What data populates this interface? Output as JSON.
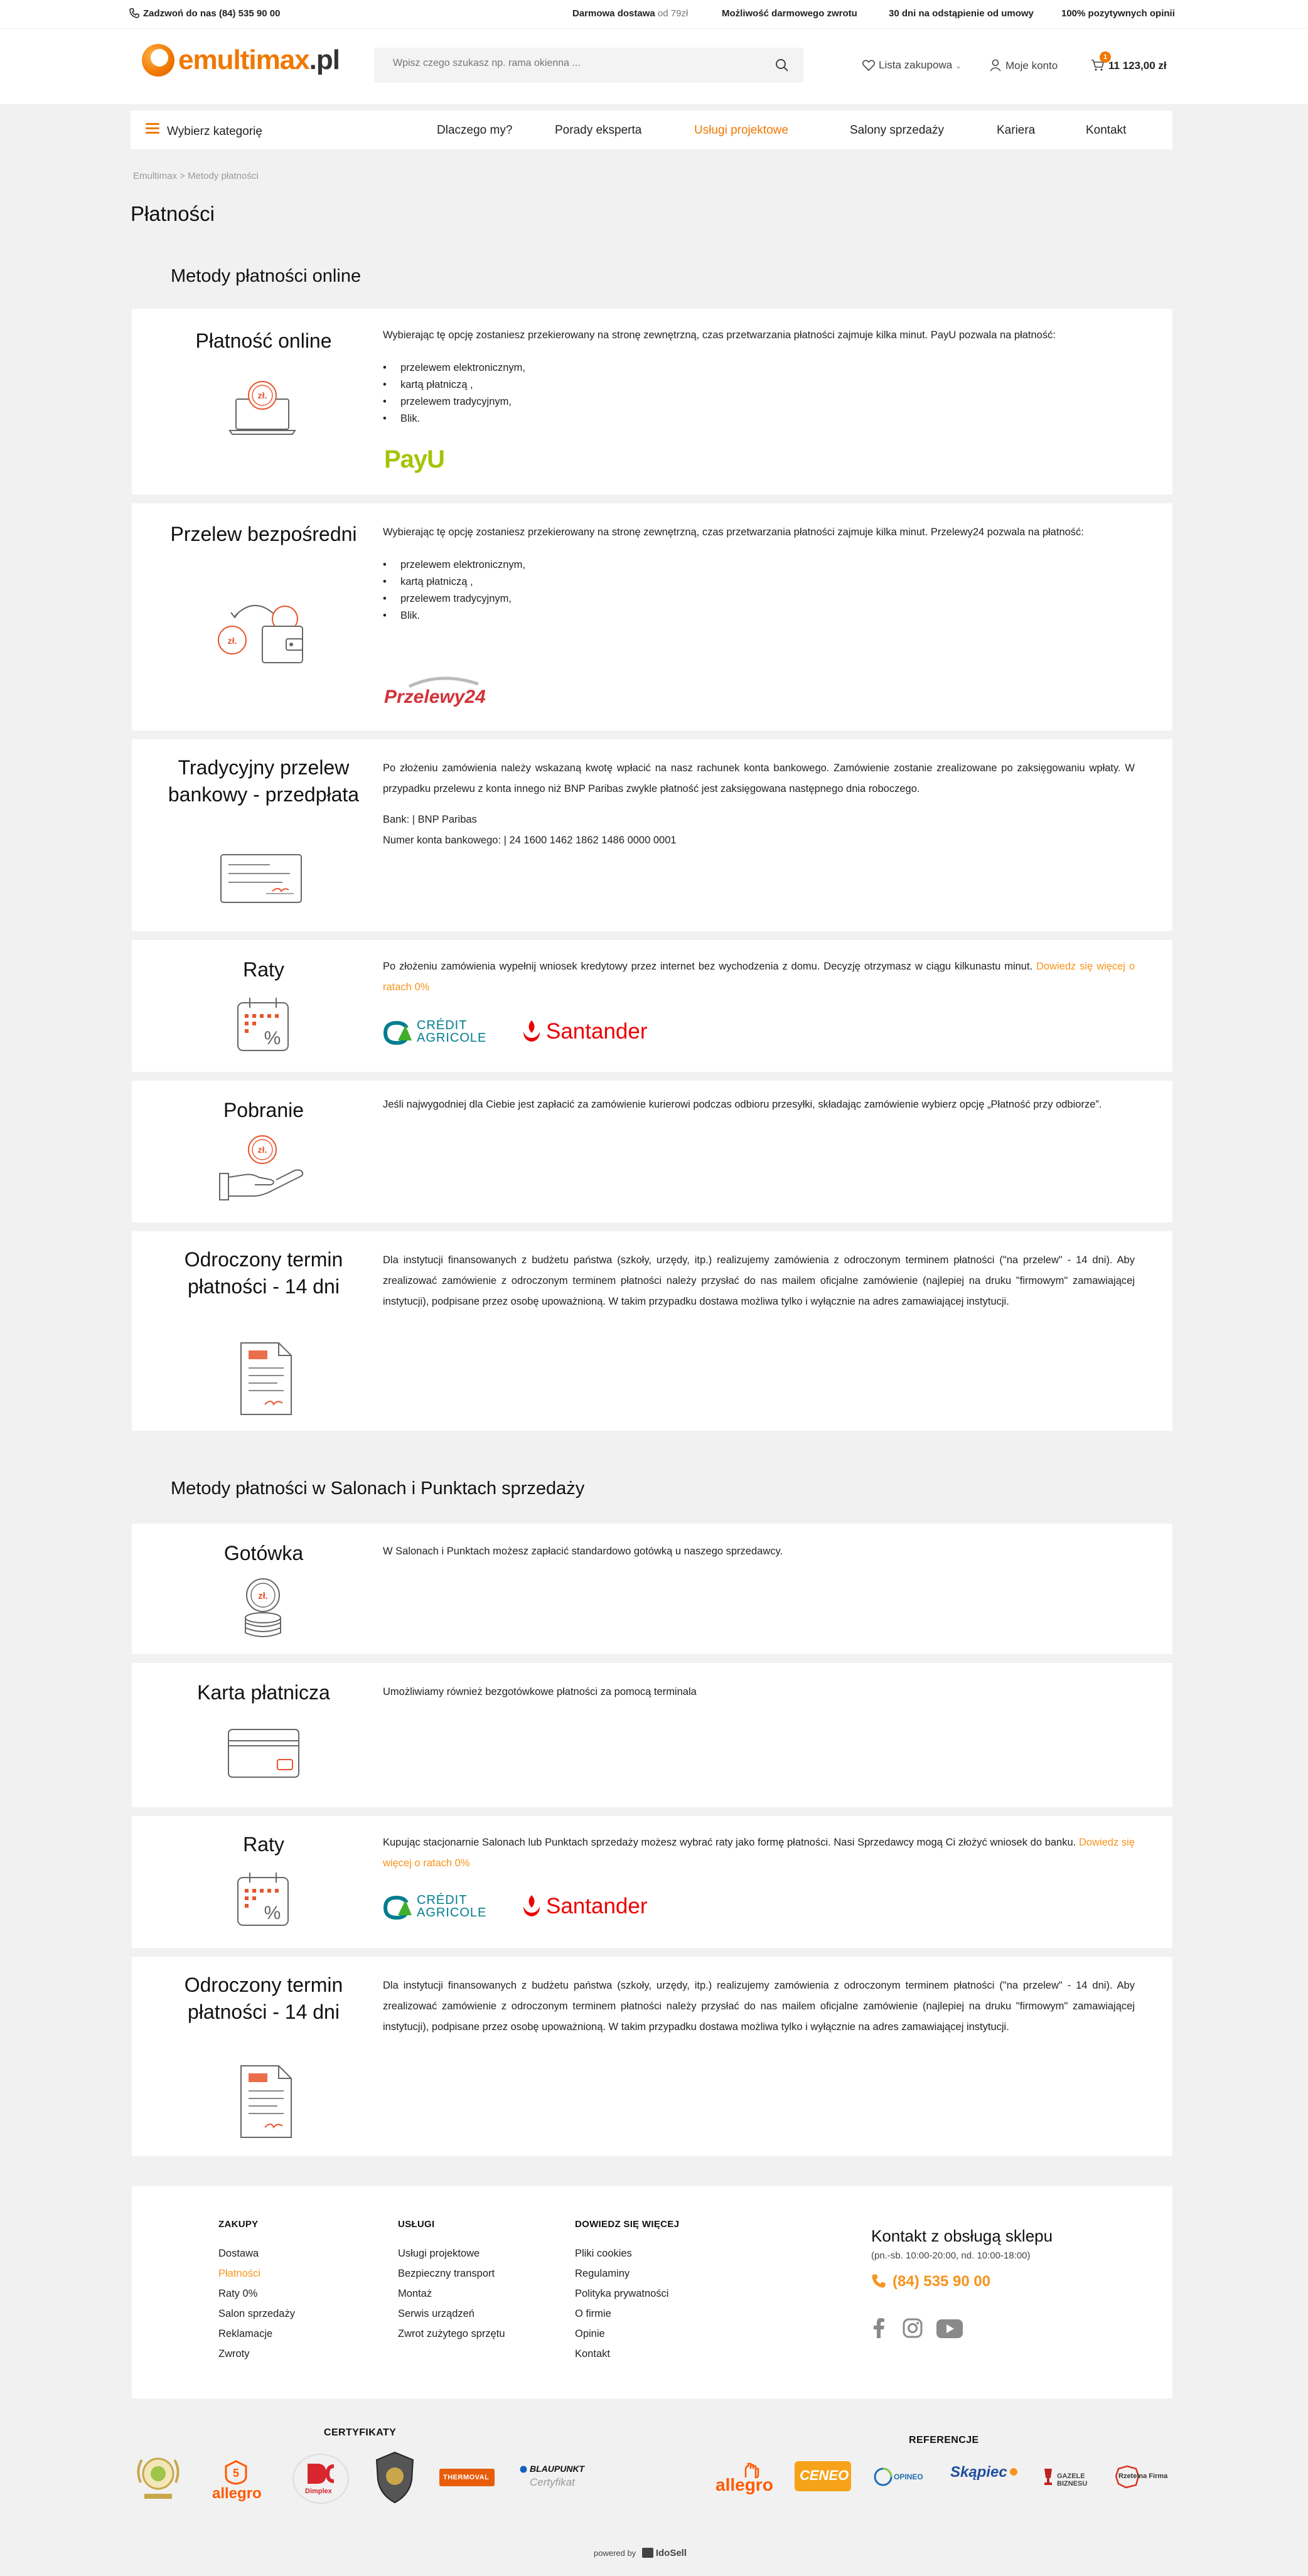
{
  "topbar": {
    "phone_label": "Zadzwoń do nas (84) 535 90 00",
    "perks": [
      {
        "bold": "Darmowa dostawa",
        "muted": " od 79zł"
      },
      {
        "bold": "Możliwość darmowego zwrotu",
        "muted": ""
      },
      {
        "bold": "30 dni na odstąpienie od umowy",
        "muted": ""
      },
      {
        "bold": "100% pozytywnych opinii",
        "muted": ""
      }
    ]
  },
  "header": {
    "logo_main": "emultimax",
    "logo_tld": ".pl",
    "search_placeholder": "Wpisz czego szukasz np. rama okienna ...",
    "wishlist_label": "Lista zakupowa",
    "account_label": "Moje konto",
    "cart_total": "11 123,00 zł",
    "cart_count": "1"
  },
  "nav": {
    "categories_label": "Wybierz kategorię",
    "items": [
      "Dlaczego my?",
      "Porady eksperta",
      "Usługi projektowe",
      "Salony sprzedaży",
      "Kariera",
      "Kontakt"
    ],
    "active_index": 2
  },
  "breadcrumb": "Emultimax > Metody płatności",
  "page_title": "Płatności",
  "sections": {
    "online_title": "Metody płatności online",
    "stores_title": "Metody płatności w Salonach i Punktach sprzedaży"
  },
  "cards": {
    "online_payment": {
      "title": "Płatność online",
      "text": "Wybierając tę opcję zostaniesz przekierowany na stronę zewnętrzną, czas przetwarzania płatności zajmuje kilka minut. PayU pozwala na płatność:",
      "bullets": [
        "przelewem elektronicznym,",
        "kartą płatniczą ,",
        "przelewem tradycyjnym,",
        "Blik."
      ],
      "brand": "PayU",
      "icon": "laptop-coin-icon"
    },
    "direct_transfer": {
      "title": "Przelew bezpośredni",
      "text": "Wybierając tę opcję zostaniesz przekierowany na stronę zewnętrzną, czas przetwarzania płatności zajmuje kilka minut. Przelewy24 pozwala na płatność:",
      "bullets": [
        "przelewem elektronicznym,",
        "kartą płatniczą ,",
        "przelewem tradycyjnym,",
        "Blik."
      ],
      "brand": "Przelewy24",
      "icon": "wallet-transfer-icon"
    },
    "bank_prepay": {
      "title": "Tradycyjny przelew bankowy - przedpłata",
      "text": "Po złożeniu zamówienia należy wskazaną kwotę wpłacić na nasz rachunek konta bankowego. Zamówienie zostanie zrealizowane po zaksięgowaniu wpłaty. W przypadku przelewu z konta innego niż BNP Paribas zwykle płatność jest zaksięgowana następnego dnia roboczego.",
      "bank_line": "Bank: | BNP Paribas",
      "account_line": "Numer konta bankowego: | 24 1600 1462 1862 1486 0000 0001",
      "icon": "bank-cheque-icon"
    },
    "installments_online": {
      "title": "Raty",
      "text": "Po złożeniu zamówienia wypełnij wniosek kredytowy przez internet bez wychodzenia z domu. Decyzję otrzymasz w ciągu kilkunastu minut. ",
      "link": "Dowiedz się więcej o ratach 0%",
      "brand_1_top": "CRÉDIT",
      "brand_1_bottom": "AGRICOLE",
      "brand_2": "Santander",
      "icon": "calendar-percent-icon"
    },
    "cash_on_delivery": {
      "title": "Pobranie",
      "text": "Jeśli najwygodniej dla Ciebie jest zapłacić za zamówienie kurierowi podczas odbioru przesyłki, składając zamówienie wybierz opcję „Płatność przy odbiorze”.",
      "icon": "hand-coin-icon"
    },
    "deferred_online": {
      "title": "Odroczony termin płatności - 14 dni",
      "text": "Dla instytucji finansowanych z budżetu państwa (szkoły, urzędy, itp.) realizujemy zamówienia z odroczonym terminem płatności (\"na przelew\" - 14 dni). Aby zrealizować zamówienie z odroczonym terminem płatności należy przysłać do nas mailem oficjalne zamówienie (najlepiej na druku \"firmowym\" zamawiającej instytucji), podpisane przez osobę upoważnioną. W takim przypadku dostawa możliwa tylko i wyłącznie na adres zamawiającej instytucji.",
      "icon": "document-icon"
    },
    "cash": {
      "title": "Gotówka",
      "text": "W Salonach i Punktach możesz zapłacić standardowo gotówką u naszego sprzedawcy.",
      "icon": "coin-stack-icon"
    },
    "card": {
      "title": "Karta płatnicza",
      "text": "Umożliwiamy również bezgotówkowe płatności za pomocą terminala",
      "icon": "credit-card-icon"
    },
    "installments_store": {
      "title": "Raty",
      "text": "Kupując stacjonarnie Salonach lub Punktach sprzedaży możesz wybrać raty jako formę płatności. Nasi Sprzedawcy mogą Ci złożyć wniosek do banku. ",
      "link": "Dowiedz się więcej o ratach 0%",
      "brand_1_top": "CRÉDIT",
      "brand_1_bottom": "AGRICOLE",
      "brand_2": "Santander",
      "icon": "calendar-percent-icon"
    },
    "deferred_store": {
      "title": "Odroczony termin płatności - 14 dni",
      "text": "Dla instytucji finansowanych z budżetu państwa (szkoły, urzędy, itp.) realizujemy zamówienia z odroczonym terminem płatności (\"na przelew\" - 14 dni). Aby zrealizować zamówienie z odroczonym terminem płatności należy przysłać do nas mailem oficjalne zamówienie (najlepiej na druku \"firmowym\" zamawiającej instytucji), podpisane przez osobę upoważnioną. W takim przypadku dostawa możliwa tylko i wyłącznie na adres zamawiającej instytucji.",
      "icon": "document-icon"
    }
  },
  "footer": {
    "col1": {
      "title": "ZAKUPY",
      "links": [
        "Dostawa",
        "Płatności",
        "Raty 0%",
        "Salon sprzedaży",
        "Reklamacje",
        "Zwroty"
      ],
      "active_index": 1
    },
    "col2": {
      "title": "USŁUGI",
      "links": [
        "Usługi projektowe",
        "Bezpieczny transport",
        "Montaż",
        "Serwis urządzeń",
        "Zwrot zużytego sprzętu"
      ]
    },
    "col3": {
      "title": "DOWIEDZ SIĘ WIĘCEJ",
      "links": [
        "Pliki cookies",
        "Regulaminy",
        "Polityka prywatności",
        "O firmie",
        "Opinie",
        "Kontakt"
      ]
    },
    "contact": {
      "title": "Kontakt z obsługą sklepu",
      "hours": "(pn.-sb. 10:00-20:00, nd. 10:00-18:00)",
      "phone": "(84) 535 90 00"
    },
    "social": [
      "facebook-icon",
      "instagram-icon",
      "youtube-icon"
    ]
  },
  "certs": {
    "title": "CERTYFIKATY",
    "items": [
      "allegro",
      "Dimplex",
      "THERMOVAL",
      "BLAUPUNKT",
      "Certyfikat"
    ]
  },
  "refs": {
    "title": "REFERENCJE",
    "items": [
      "allegro",
      "CENEO",
      "OPINEO",
      "Skąpiec",
      "GAZELE BIZNESU",
      "Rzetelna Firma"
    ]
  },
  "powered": {
    "label": "powered by",
    "brand": "IdoSell"
  },
  "colors": {
    "accent": "#f07800",
    "link": "#f7941d",
    "background": "#f1f1f1",
    "santander": "#ec0000",
    "credit_agricole": "#007d8f",
    "payu": "#a6c307",
    "przelewy": "#d13239"
  }
}
